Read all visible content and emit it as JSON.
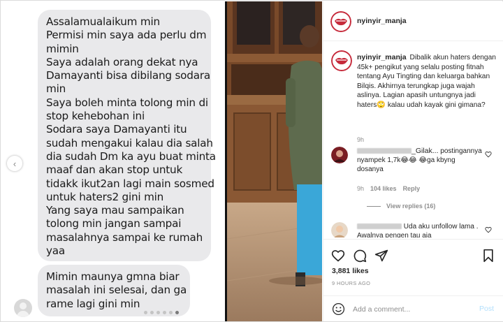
{
  "post": {
    "username": "nyinyir_manja",
    "caption_text": "Dibalik akun haters dengan 45k+ pengikut yang selalu posting fitnah tentang Ayu Tingting dan keluarga bahkan Bilqis. Akhirnya terungkap juga wajah aslinya. Lagian apasih untungnya jadi haters🙄 kalau udah kayak gini gimana?",
    "caption_time": "9h",
    "likes": "3,881 likes",
    "posted": "9 HOURS AGO"
  },
  "chat": {
    "bubble1_lines": [
      "Assalamualaikum min",
      "Permisi min saya ada perlu dm",
      "mimin",
      "Saya adalah orang dekat nya",
      "Damayanti bisa dibilang sodara",
      "min",
      "Saya boleh minta tolong min di",
      "stop kehebohan ini",
      "Sodara saya Damayanti itu",
      "sudah mengakui kalau dia salah",
      "dia sudah Dm ka ayu buat minta",
      "maaf dan akan stop untuk",
      "tidakk ikut2an lagi main sosmed",
      "untuk haters2 gini min",
      "Yang saya mau sampaikan",
      "tolong min jangan sampai",
      "masalahnya sampai ke rumah",
      "yaa"
    ],
    "bubble2_lines": [
      "Mimin maunya gmna biar",
      "masalah ini selesai,  dan ga",
      "rame lagi gini min"
    ]
  },
  "comments": [
    {
      "username_suffix": "_Gilak...",
      "text": "postingannya nyampek 1,7k😂😂 😂ga kbyng dosanya",
      "time": "9h",
      "likes": "104 likes",
      "reply": "Reply",
      "view_replies": "View replies (16)"
    },
    {
      "text": "Uda aku unfollow lama . Awalnya pengen tau aja"
    }
  ],
  "add_comment": {
    "placeholder": "Add a comment...",
    "post_label": "Post"
  },
  "icons": {
    "heart": "heart-icon",
    "comment": "comment-icon",
    "share": "paper-plane-icon",
    "save": "bookmark-icon",
    "emoji": "smiley-icon",
    "carousel_prev": "chevron-left-icon"
  },
  "colors": {
    "bubble": "#e9e9eb",
    "post_button": "#b2dffc",
    "muted_text": "#8e8e8e"
  }
}
